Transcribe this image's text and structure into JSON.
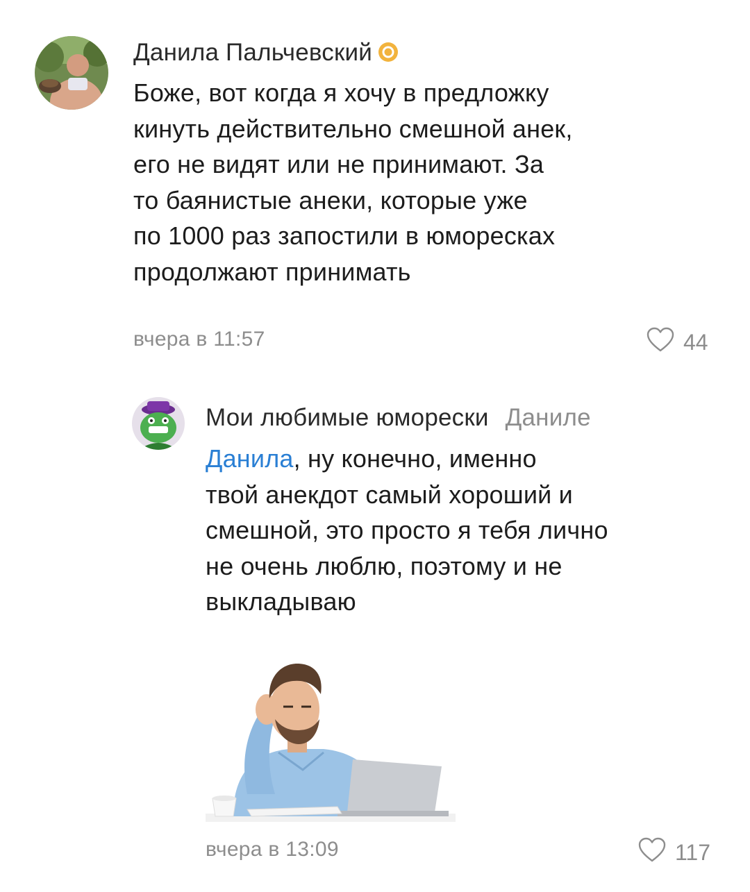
{
  "comments": [
    {
      "author": "Данила Пальчевский",
      "text_lines": [
        "Боже, вот когда я хочу в предложку",
        "кинуть действительно смешной анек,",
        "его не видят или не принимают. За",
        "то баянистые анеки, которые уже",
        "по 1000 раз запостили в юморесках",
        "продолжают принимать"
      ],
      "time": "вчера в 11:57",
      "likes": "44"
    },
    {
      "author": "Мои любимые юморески",
      "reply_to": "Даниле",
      "mention": "Данила",
      "first_line_rest": ", ну конечно, именно",
      "text_lines": [
        "твой анекдот самый хороший и",
        "смешной, это просто я тебя лично",
        "не очень люблю, поэтому и не",
        "выкладываю"
      ],
      "time": "вчера в 13:09",
      "likes": "117"
    }
  ],
  "icons": {
    "badge": "verified-badge-icon",
    "like": "heart-outline-icon"
  },
  "colors": {
    "mention": "#2a7fd4",
    "muted": "#8d8d8d",
    "badge": "#f2b33d"
  }
}
